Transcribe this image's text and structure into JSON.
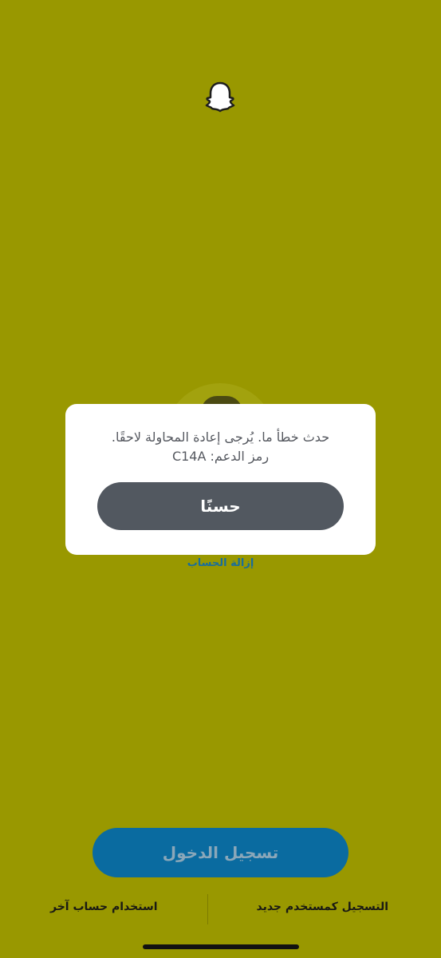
{
  "app": {
    "logo_icon": "snapchat-ghost-icon"
  },
  "account": {
    "remove_label": "إزالة الحساب"
  },
  "dialog": {
    "message_line1": "حدث خطأ ما. يُرجى إعادة المحاولة لاحقًا.",
    "message_line2": "رمز الدعم: C14A",
    "ok_label": "حسنًا"
  },
  "actions": {
    "login_label": "تسجيل الدخول",
    "register_label": "التسجيل كمستخدم جديد",
    "other_account_label": "استخدام حساب آخر"
  },
  "colors": {
    "background": "#999800",
    "dialog_button": "#525860",
    "login_button": "#0a6ba0",
    "link": "#1a6e9a"
  }
}
